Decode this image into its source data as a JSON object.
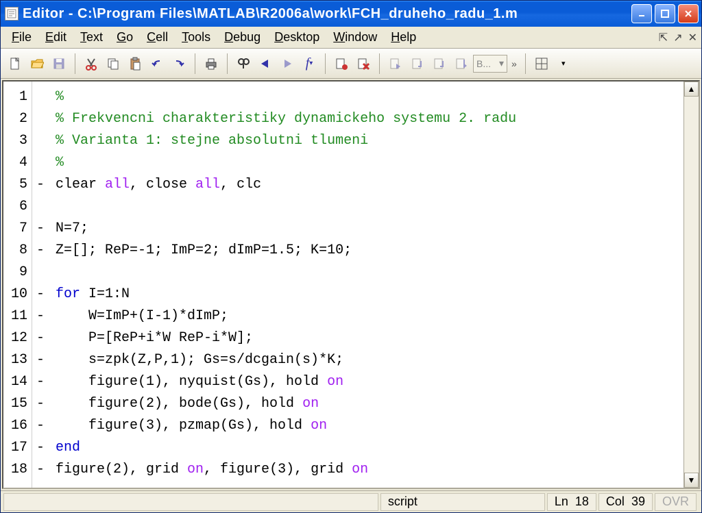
{
  "window": {
    "title": "Editor - C:\\Program Files\\MATLAB\\R2006a\\work\\FCH_druheho_radu_1.m"
  },
  "menubar": {
    "items": [
      {
        "label": "File",
        "u": "F"
      },
      {
        "label": "Edit",
        "u": "E"
      },
      {
        "label": "Text",
        "u": "T"
      },
      {
        "label": "Go",
        "u": "G"
      },
      {
        "label": "Cell",
        "u": "C"
      },
      {
        "label": "Tools",
        "u": "T"
      },
      {
        "label": "Debug",
        "u": "D"
      },
      {
        "label": "Desktop",
        "u": "D"
      },
      {
        "label": "Window",
        "u": "W"
      },
      {
        "label": "Help",
        "u": "H"
      }
    ]
  },
  "toolbar": {
    "base_label": "B..."
  },
  "status": {
    "type": "script",
    "line_label": "Ln",
    "line": "18",
    "col_label": "Col",
    "col": "39",
    "ovr": "OVR"
  },
  "code": {
    "lines": [
      {
        "n": "1",
        "m": "",
        "tokens": [
          {
            "t": "%",
            "c": "comment"
          }
        ]
      },
      {
        "n": "2",
        "m": "",
        "tokens": [
          {
            "t": "% Frekvencni charakteristiky dynamickeho systemu 2. radu",
            "c": "comment"
          }
        ]
      },
      {
        "n": "3",
        "m": "",
        "tokens": [
          {
            "t": "% Varianta 1: stejne absolutni tlumeni",
            "c": "comment"
          }
        ]
      },
      {
        "n": "4",
        "m": "",
        "tokens": [
          {
            "t": "%",
            "c": "comment"
          }
        ]
      },
      {
        "n": "5",
        "m": "-",
        "tokens": [
          {
            "t": "clear ",
            "c": "default"
          },
          {
            "t": "all",
            "c": "string"
          },
          {
            "t": ", close ",
            "c": "default"
          },
          {
            "t": "all",
            "c": "string"
          },
          {
            "t": ", clc",
            "c": "default"
          }
        ]
      },
      {
        "n": "6",
        "m": "",
        "tokens": []
      },
      {
        "n": "7",
        "m": "-",
        "tokens": [
          {
            "t": "N=7;",
            "c": "default"
          }
        ]
      },
      {
        "n": "8",
        "m": "-",
        "tokens": [
          {
            "t": "Z=[]; ReP=-1; ImP=2; dImP=1.5; K=10;",
            "c": "default"
          }
        ]
      },
      {
        "n": "9",
        "m": "",
        "tokens": []
      },
      {
        "n": "10",
        "m": "-",
        "tokens": [
          {
            "t": "for ",
            "c": "keyword"
          },
          {
            "t": "I=1:N",
            "c": "default"
          }
        ]
      },
      {
        "n": "11",
        "m": "-",
        "tokens": [
          {
            "t": "    W=ImP+(I-1)*dImP;",
            "c": "default"
          }
        ]
      },
      {
        "n": "12",
        "m": "-",
        "tokens": [
          {
            "t": "    P=[ReP+i*W ReP-i*W];",
            "c": "default"
          }
        ]
      },
      {
        "n": "13",
        "m": "-",
        "tokens": [
          {
            "t": "    s=zpk(Z,P,1); Gs=s/dcgain(s)*K;",
            "c": "default"
          }
        ]
      },
      {
        "n": "14",
        "m": "-",
        "tokens": [
          {
            "t": "    figure(1), nyquist(Gs), hold ",
            "c": "default"
          },
          {
            "t": "on",
            "c": "string"
          }
        ]
      },
      {
        "n": "15",
        "m": "-",
        "tokens": [
          {
            "t": "    figure(2), bode(Gs), hold ",
            "c": "default"
          },
          {
            "t": "on",
            "c": "string"
          }
        ]
      },
      {
        "n": "16",
        "m": "-",
        "tokens": [
          {
            "t": "    figure(3), pzmap(Gs), hold ",
            "c": "default"
          },
          {
            "t": "on",
            "c": "string"
          }
        ]
      },
      {
        "n": "17",
        "m": "-",
        "tokens": [
          {
            "t": "end",
            "c": "keyword"
          }
        ]
      },
      {
        "n": "18",
        "m": "-",
        "tokens": [
          {
            "t": "figure(2), grid ",
            "c": "default"
          },
          {
            "t": "on",
            "c": "string"
          },
          {
            "t": ", figure(3), grid ",
            "c": "default"
          },
          {
            "t": "on",
            "c": "string"
          }
        ]
      }
    ]
  }
}
